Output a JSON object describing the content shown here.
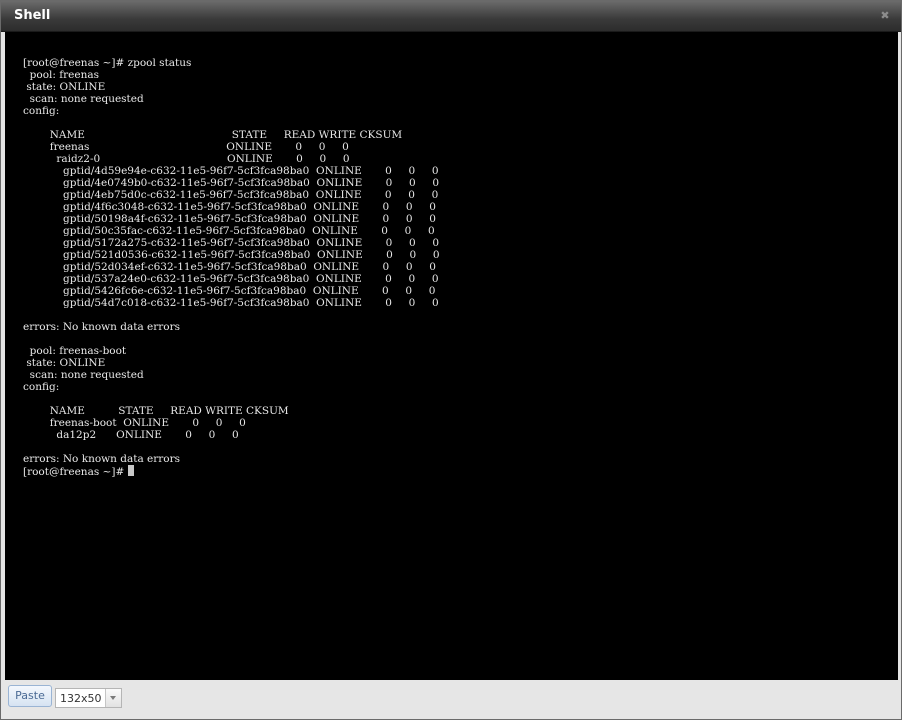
{
  "window": {
    "title": "Shell",
    "close_icon": "close-icon"
  },
  "terminal": {
    "lines": [
      "[root@freenas ~]# zpool status",
      "  pool: freenas",
      " state: ONLINE",
      "  scan: none requested",
      "config:",
      "",
      "        NAME                                            STATE     READ WRITE CKSUM",
      "        freenas                                         ONLINE       0     0     0",
      "          raidz2-0                                      ONLINE       0     0     0",
      "            gptid/4d59e94e-c632-11e5-96f7-5cf3fca98ba0  ONLINE       0     0     0",
      "            gptid/4e0749b0-c632-11e5-96f7-5cf3fca98ba0  ONLINE       0     0     0",
      "            gptid/4eb75d0c-c632-11e5-96f7-5cf3fca98ba0  ONLINE       0     0     0",
      "            gptid/4f6c3048-c632-11e5-96f7-5cf3fca98ba0  ONLINE       0     0     0",
      "            gptid/50198a4f-c632-11e5-96f7-5cf3fca98ba0  ONLINE       0     0     0",
      "            gptid/50c35fac-c632-11e5-96f7-5cf3fca98ba0  ONLINE       0     0     0",
      "            gptid/5172a275-c632-11e5-96f7-5cf3fca98ba0  ONLINE       0     0     0",
      "            gptid/521d0536-c632-11e5-96f7-5cf3fca98ba0  ONLINE       0     0     0",
      "            gptid/52d034ef-c632-11e5-96f7-5cf3fca98ba0  ONLINE       0     0     0",
      "            gptid/537a24e0-c632-11e5-96f7-5cf3fca98ba0  ONLINE       0     0     0",
      "            gptid/5426fc6e-c632-11e5-96f7-5cf3fca98ba0  ONLINE       0     0     0",
      "            gptid/54d7c018-c632-11e5-96f7-5cf3fca98ba0  ONLINE       0     0     0",
      "",
      "errors: No known data errors",
      "",
      "  pool: freenas-boot",
      " state: ONLINE",
      "  scan: none requested",
      "config:",
      "",
      "        NAME          STATE     READ WRITE CKSUM",
      "        freenas-boot  ONLINE       0     0     0",
      "          da12p2      ONLINE       0     0     0",
      "",
      "errors: No known data errors"
    ],
    "prompt": "[root@freenas ~]# "
  },
  "toolbar": {
    "paste_label": "Paste",
    "size_value": "132x50"
  }
}
